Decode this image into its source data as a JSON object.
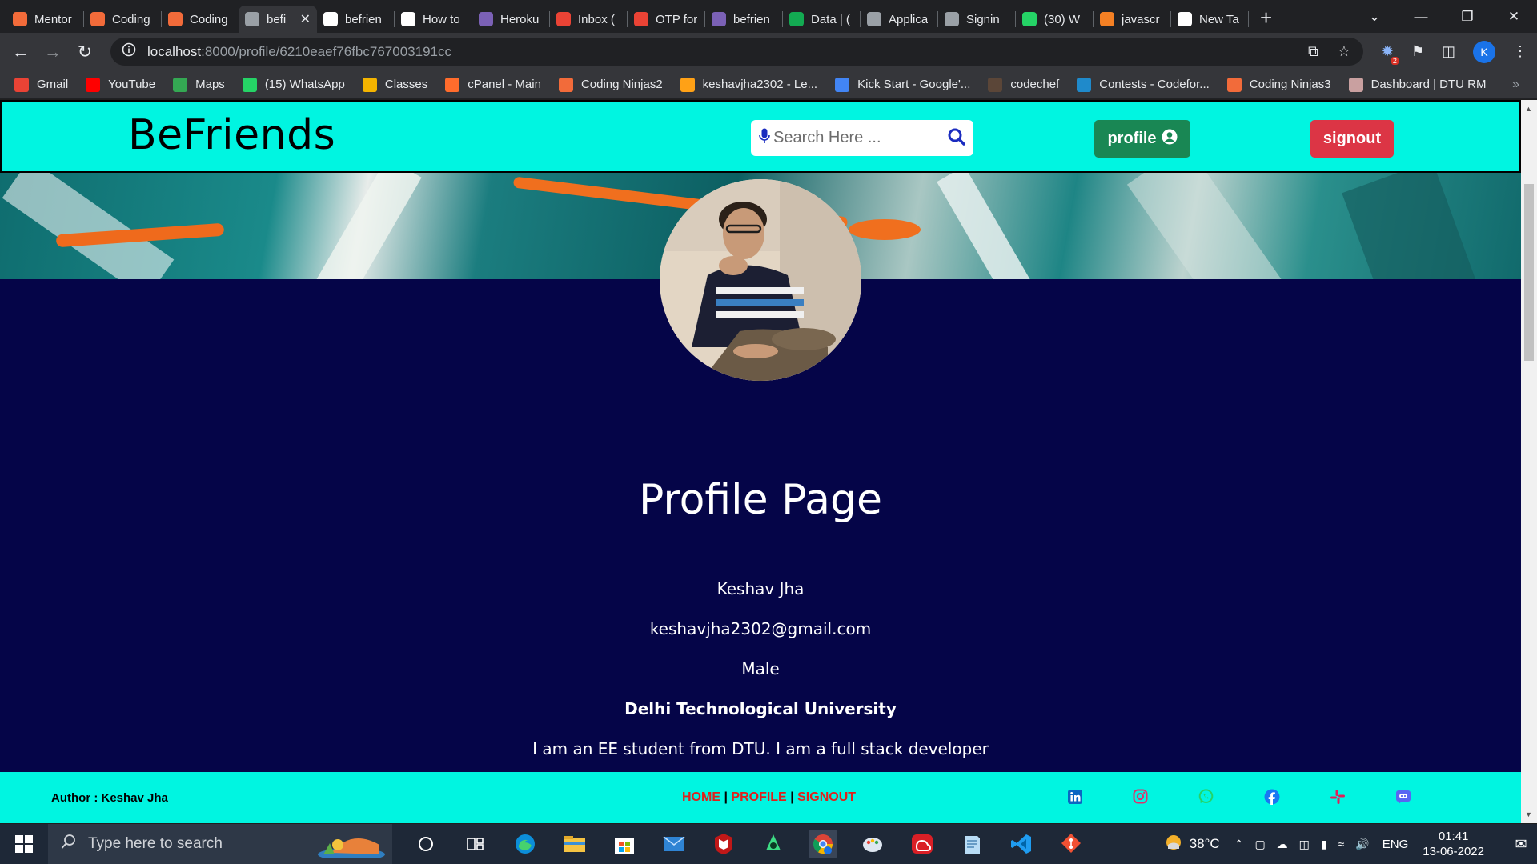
{
  "browser": {
    "tabs": [
      {
        "title": "Mentor",
        "icon": "coding-ninjas-icon",
        "color": "#f26b3a"
      },
      {
        "title": "Coding",
        "icon": "coding-ninjas-icon",
        "color": "#f26b3a"
      },
      {
        "title": "Coding",
        "icon": "coding-ninjas-icon",
        "color": "#f26b3a"
      },
      {
        "title": "befi",
        "icon": "globe-icon",
        "color": "#9aa0a6",
        "active": true
      },
      {
        "title": "befrien",
        "icon": "github-icon",
        "color": "#ffffff"
      },
      {
        "title": "How to",
        "icon": "medium-icon",
        "color": "#ffffff"
      },
      {
        "title": "Heroku",
        "icon": "heroku-icon",
        "color": "#7b61b6"
      },
      {
        "title": "Inbox (",
        "icon": "gmail-icon",
        "color": "#ea4335"
      },
      {
        "title": "OTP for",
        "icon": "gmail-icon",
        "color": "#ea4335"
      },
      {
        "title": "befrien",
        "icon": "heroku-icon",
        "color": "#7b61b6"
      },
      {
        "title": "Data | (",
        "icon": "mongodb-icon",
        "color": "#13aa52"
      },
      {
        "title": "Applica",
        "icon": "globe-icon",
        "color": "#9aa0a6"
      },
      {
        "title": "Signin",
        "icon": "globe-icon",
        "color": "#9aa0a6"
      },
      {
        "title": "(30) W",
        "icon": "whatsapp-icon",
        "color": "#25d366"
      },
      {
        "title": "javascr",
        "icon": "stackoverflow-icon",
        "color": "#f48024"
      },
      {
        "title": "New Ta",
        "icon": "chrome-icon",
        "color": "#ffffff"
      }
    ],
    "url_host": "localhost",
    "url_path": ":8000/profile/6210eaef76fbc767003191cc",
    "profile_initial": "K",
    "extension_badge": "2",
    "bookmarks": [
      {
        "label": "Gmail",
        "icon": "gmail-icon",
        "color": "#ea4335"
      },
      {
        "label": "YouTube",
        "icon": "youtube-icon",
        "color": "#ff0000"
      },
      {
        "label": "Maps",
        "icon": "maps-icon",
        "color": "#34a853"
      },
      {
        "label": "(15) WhatsApp",
        "icon": "whatsapp-icon",
        "color": "#25d366"
      },
      {
        "label": "Classes",
        "icon": "classroom-icon",
        "color": "#f4b400"
      },
      {
        "label": "cPanel - Main",
        "icon": "cpanel-icon",
        "color": "#ff6c2c"
      },
      {
        "label": "Coding Ninjas2",
        "icon": "coding-ninjas-icon",
        "color": "#f26b3a"
      },
      {
        "label": "keshavjha2302 - Le...",
        "icon": "leetcode-icon",
        "color": "#ffa116"
      },
      {
        "label": "Kick Start - Google'...",
        "icon": "google-icon",
        "color": "#4285f4"
      },
      {
        "label": "codechef",
        "icon": "codechef-icon",
        "color": "#5b4638"
      },
      {
        "label": "Contests - Codefor...",
        "icon": "codeforces-icon",
        "color": "#1f8acb"
      },
      {
        "label": "Coding Ninjas3",
        "icon": "coding-ninjas-icon",
        "color": "#f26b3a"
      },
      {
        "label": "Dashboard | DTU RM",
        "icon": "dtu-icon",
        "color": "#c9a0a0"
      }
    ]
  },
  "site": {
    "brand": "BeFriends",
    "search_placeholder": "Search Here ...",
    "profile_label": "profile",
    "signout_label": "signout",
    "page_title": "Profile Page",
    "user": {
      "name": "Keshav Jha",
      "email": "keshavjha2302@gmail.com",
      "gender": "Male",
      "college": "Delhi Technological University",
      "bio": "I am an EE student from DTU. I am a full stack developer"
    },
    "footer": {
      "author": "Author : Keshav Jha",
      "home": "HOME",
      "profile": "PROFILE",
      "signout": "SIGNOUT",
      "sep": "|",
      "socials": [
        {
          "name": "linkedin-icon",
          "color": "#0a66c2"
        },
        {
          "name": "instagram-icon",
          "color": "#e1306c"
        },
        {
          "name": "whatsapp-icon",
          "color": "#25d366"
        },
        {
          "name": "facebook-icon",
          "color": "#1877f2"
        },
        {
          "name": "slack-icon",
          "color": "#e01e5a"
        },
        {
          "name": "discord-icon",
          "color": "#5865f2"
        }
      ]
    },
    "colors": {
      "header_bg": "#00f5e1",
      "page_bg": "#050548",
      "profile_btn": "#198754",
      "signout_btn": "#dc3545"
    }
  },
  "taskbar": {
    "search_placeholder": "Type here to search",
    "temperature": "38°C",
    "language": "ENG",
    "time": "01:41",
    "date": "13-06-2022"
  }
}
